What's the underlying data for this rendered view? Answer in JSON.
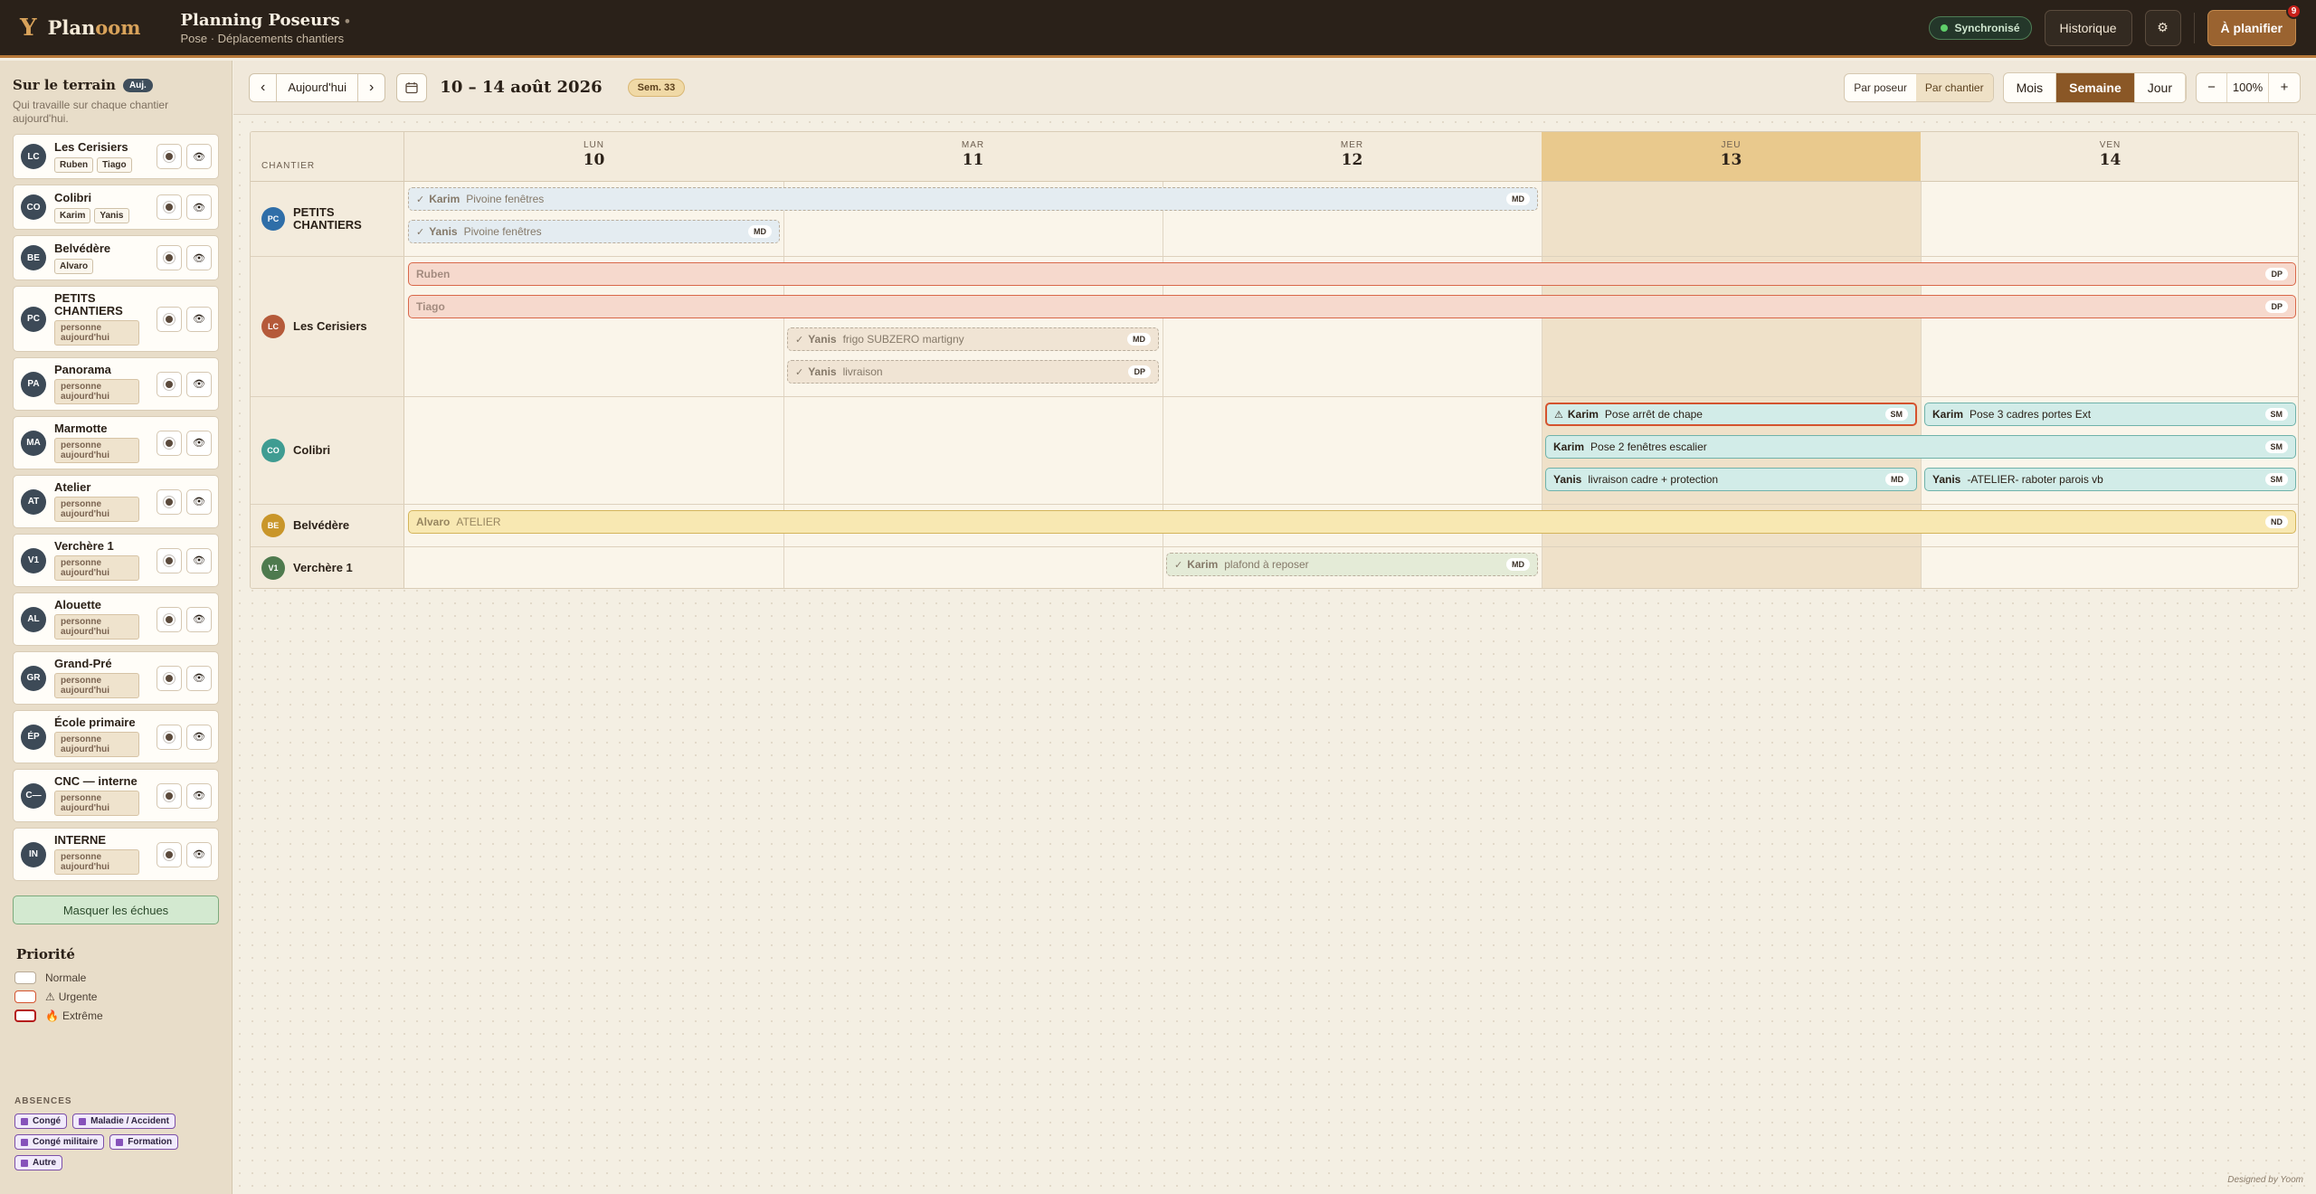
{
  "app": {
    "logo_prefix": "Plan",
    "logo_suffix": "oom",
    "title": "Planning Poseurs",
    "subtitle": "Pose · Déplacements chantiers",
    "sync_label": "Synchronisé",
    "history_label": "Historique",
    "settings_icon": "gear-icon",
    "plan_label": "À planifier",
    "plan_count": "9"
  },
  "sidebar": {
    "title": "Sur le terrain",
    "today_badge": "Auj.",
    "subtitle": "Qui travaille sur chaque chantier aujourd'hui.",
    "nobody_label": "personne aujourd'hui",
    "sites": [
      {
        "initials": "LC",
        "name": "Les Cerisiers",
        "workers": [
          "Ruben",
          "Tiago"
        ],
        "color": "#3d4a57"
      },
      {
        "initials": "CO",
        "name": "Colibri",
        "workers": [
          "Karim",
          "Yanis"
        ],
        "color": "#3d4a57"
      },
      {
        "initials": "BE",
        "name": "Belvédère",
        "workers": [
          "Alvaro"
        ],
        "color": "#3d4a57"
      },
      {
        "initials": "PC",
        "name": "PETITS CHANTIERS",
        "workers": [],
        "color": "#3d4a57"
      },
      {
        "initials": "PA",
        "name": "Panorama",
        "workers": [],
        "color": "#3d4a57"
      },
      {
        "initials": "MA",
        "name": "Marmotte",
        "workers": [],
        "color": "#3d4a57"
      },
      {
        "initials": "AT",
        "name": "Atelier",
        "workers": [],
        "color": "#3d4a57"
      },
      {
        "initials": "V1",
        "name": "Verchère 1",
        "workers": [],
        "color": "#3d4a57"
      },
      {
        "initials": "AL",
        "name": "Alouette",
        "workers": [],
        "color": "#3d4a57"
      },
      {
        "initials": "GR",
        "name": "Grand-Pré",
        "workers": [],
        "color": "#3d4a57"
      },
      {
        "initials": "ÉP",
        "name": "École primaire",
        "workers": [],
        "color": "#3d4a57"
      },
      {
        "initials": "C—",
        "name": "CNC — interne",
        "workers": [],
        "color": "#3d4a57"
      },
      {
        "initials": "IN",
        "name": "INTERNE",
        "workers": [],
        "color": "#3d4a57"
      }
    ],
    "hide_label": "Masquer les échues",
    "priority_title": "Priorité",
    "priorities": [
      {
        "label": "Normale",
        "icon": "",
        "border": "#b8aa96"
      },
      {
        "label": "Urgente",
        "icon": "⚠",
        "border": "#d4532e"
      },
      {
        "label": "Extrême",
        "icon": "🔥",
        "border": "#b51a1a"
      }
    ],
    "absences_title": "ABSENCES",
    "absences": [
      "Congé",
      "Maladie / Accident",
      "Congé militaire",
      "Formation",
      "Autre"
    ]
  },
  "toolbar": {
    "prev": "‹",
    "today": "Aujourd'hui",
    "next": "›",
    "calendar_icon": "calendar-icon",
    "range": "10 – 14 août 2026",
    "week": "Sem. 33",
    "group_by": [
      "Par poseur",
      "Par chantier"
    ],
    "group_active": "Par chantier",
    "views": [
      "Mois",
      "Semaine",
      "Jour"
    ],
    "view_active": "Semaine",
    "zoom_out": "−",
    "zoom": "100%",
    "zoom_in": "+"
  },
  "grid": {
    "chantier_label": "CHANTIER",
    "days": [
      {
        "name": "LUN",
        "num": "10",
        "today": false
      },
      {
        "name": "MAR",
        "num": "11",
        "today": false
      },
      {
        "name": "MER",
        "num": "12",
        "today": false
      },
      {
        "name": "JEU",
        "num": "13",
        "today": true
      },
      {
        "name": "VEN",
        "num": "14",
        "today": false
      }
    ],
    "rows": [
      {
        "initials": "PC",
        "name": "PETITS CHANTIERS",
        "color": "#2f6ea8",
        "lanes": 2
      },
      {
        "initials": "LC",
        "name": "Les Cerisiers",
        "color": "#b55a3a",
        "lanes": 4
      },
      {
        "initials": "CO",
        "name": "Colibri",
        "color": "#3f9c92",
        "lanes": 3
      },
      {
        "initials": "BE",
        "name": "Belvédère",
        "color": "#c9962a",
        "lanes": 1
      },
      {
        "initials": "V1",
        "name": "Verchère 1",
        "color": "#4e7a4e",
        "lanes": 1
      }
    ],
    "events": [
      {
        "row": 0,
        "lane": 0,
        "start": 0,
        "span": 3,
        "who": "Karim",
        "text": "Pivoine fenêtres",
        "tag": "MD",
        "style": "past blue",
        "done": true
      },
      {
        "row": 0,
        "lane": 1,
        "start": 0,
        "span": 1,
        "who": "Yanis",
        "text": "Pivoine fenêtres",
        "tag": "MD",
        "style": "past blue",
        "done": true
      },
      {
        "row": 1,
        "lane": 0,
        "start": 0,
        "span": 5,
        "who": "Ruben",
        "text": "",
        "tag": "DP",
        "style": "rose",
        "done": false
      },
      {
        "row": 1,
        "lane": 1,
        "start": 0,
        "span": 5,
        "who": "Tiago",
        "text": "",
        "tag": "DP",
        "style": "rose",
        "done": false
      },
      {
        "row": 1,
        "lane": 2,
        "start": 1,
        "span": 1,
        "who": "Yanis",
        "text": "frigo SUBZERO martigny",
        "tag": "MD",
        "style": "past tan",
        "done": true
      },
      {
        "row": 1,
        "lane": 3,
        "start": 1,
        "span": 1,
        "who": "Yanis",
        "text": "livraison",
        "tag": "DP",
        "style": "past tan",
        "done": true
      },
      {
        "row": 2,
        "lane": 0,
        "start": 3,
        "span": 1,
        "who": "Karim",
        "text": "Pose arrêt de chape",
        "tag": "SM",
        "style": "teal urg",
        "done": false,
        "warn": true
      },
      {
        "row": 2,
        "lane": 0,
        "start": 4,
        "span": 1,
        "who": "Karim",
        "text": "Pose 3 cadres portes Ext",
        "tag": "SM",
        "style": "teal",
        "done": false
      },
      {
        "row": 2,
        "lane": 1,
        "start": 3,
        "span": 2,
        "who": "Karim",
        "text": "Pose 2 fenêtres escalier",
        "tag": "SM",
        "style": "teal",
        "done": false
      },
      {
        "row": 2,
        "lane": 2,
        "start": 3,
        "span": 1,
        "who": "Yanis",
        "text": "livraison cadre + protection",
        "tag": "MD",
        "style": "teal",
        "done": false
      },
      {
        "row": 2,
        "lane": 2,
        "start": 4,
        "span": 1,
        "who": "Yanis",
        "text": "-ATELIER- raboter parois vb",
        "tag": "SM",
        "style": "teal",
        "done": false
      },
      {
        "row": 3,
        "lane": 0,
        "start": 0,
        "span": 5,
        "who": "Alvaro",
        "text": "ATELIER",
        "tag": "ND",
        "style": "yellow",
        "done": false
      },
      {
        "row": 4,
        "lane": 0,
        "start": 2,
        "span": 1,
        "who": "Karim",
        "text": "plafond à reposer",
        "tag": "MD",
        "style": "past green",
        "done": true
      }
    ]
  },
  "footer": {
    "designed": "Designed by Yoom"
  }
}
